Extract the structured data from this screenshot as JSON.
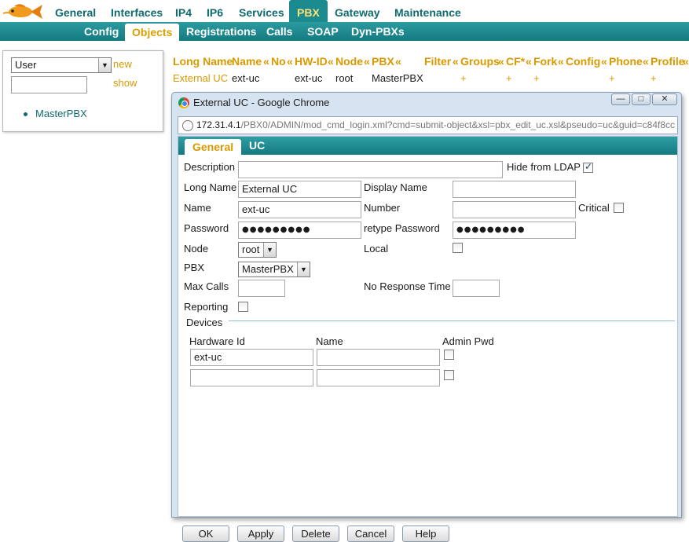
{
  "topnav": {
    "items": [
      "General",
      "Interfaces",
      "IP4",
      "IP6",
      "Services",
      "PBX",
      "Gateway",
      "Maintenance"
    ],
    "active": "PBX"
  },
  "subnav": {
    "items": [
      "Config",
      "Objects",
      "Registrations",
      "Calls",
      "SOAP",
      "Dyn-PBXs"
    ],
    "active": "Objects"
  },
  "leftpanel": {
    "type_select": "User",
    "new_label": "new",
    "filter_value": "",
    "show_label": "show",
    "tree": [
      "MasterPBX"
    ]
  },
  "table": {
    "headers": [
      "Long Name",
      "Name",
      "«",
      "No",
      "«",
      "HW-ID",
      "«",
      "Node",
      "«",
      "PBX",
      "«",
      "Filter",
      "«",
      "Groups",
      "«",
      "CF*",
      "«",
      "Fork",
      "«",
      "Config",
      "«",
      "Phone",
      "«",
      "Profile",
      "«"
    ],
    "row": {
      "long_name": "External UC",
      "name": "ext-uc",
      "hwid": "ext-uc",
      "node": "root",
      "pbx": "MasterPBX",
      "plus": "+"
    }
  },
  "popup": {
    "title": "External UC - Google Chrome",
    "controls": {
      "minimize": "—",
      "maximize": "□",
      "close": "✕"
    },
    "url_host": "172.31.4.1",
    "url_path": "/PBX0/ADMIN/mod_cmd_login.xml?cmd=submit-object&xsl=pbx_edit_uc.xsl&pseudo=uc&guid=c84f8cc",
    "tabs": [
      "General",
      "UC"
    ],
    "active_tab": "General",
    "form": {
      "description_label": "Description",
      "description_value": "",
      "hide_ldap_label": "Hide from LDAP",
      "hide_ldap_checked": true,
      "long_name_label": "Long Name",
      "long_name_value": "External UC",
      "display_name_label": "Display Name",
      "display_name_value": "",
      "name_label": "Name",
      "name_value": "ext-uc",
      "number_label": "Number",
      "number_value": "",
      "critical_label": "Critical",
      "critical_checked": false,
      "password_label": "Password",
      "password_value": "●●●●●●●●●",
      "retype_password_label": "retype Password",
      "retype_password_value": "●●●●●●●●●",
      "node_label": "Node",
      "node_value": "root",
      "local_label": "Local",
      "local_checked": false,
      "pbx_label": "PBX",
      "pbx_value": "MasterPBX",
      "max_calls_label": "Max Calls",
      "max_calls_value": "",
      "no_response_label": "No Response Time",
      "no_response_value": "",
      "reporting_label": "Reporting",
      "reporting_checked": false
    },
    "devices": {
      "title": "Devices",
      "columns": [
        "Hardware Id",
        "Name",
        "Admin Pwd"
      ],
      "rows": [
        {
          "hwid": "ext-uc",
          "name": "",
          "admin_pwd": false
        },
        {
          "hwid": "",
          "name": "",
          "admin_pwd": false
        }
      ]
    },
    "buttons": [
      "OK",
      "Apply",
      "Delete",
      "Cancel",
      "Help"
    ]
  }
}
